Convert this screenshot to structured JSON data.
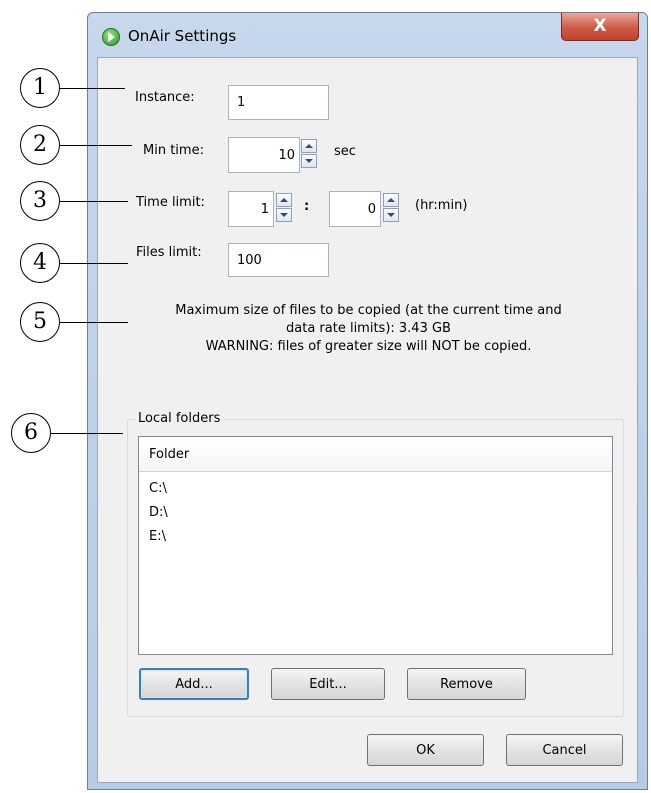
{
  "window": {
    "title": "OnAir Settings",
    "close_label": "X"
  },
  "instance": {
    "label": "Instance:",
    "value": "1"
  },
  "min_time": {
    "label": "Min time:",
    "value": "10",
    "unit": "sec"
  },
  "time_limit": {
    "label": "Time limit:",
    "hours": "1",
    "separator": ":",
    "minutes": "0",
    "unit": "(hr:min)"
  },
  "files_limit": {
    "label": "Files limit:",
    "value": "100"
  },
  "info": {
    "line1": "Maximum size of files to be copied (at the current time and",
    "line2": "data rate limits): 3.43 GB",
    "line3": "WARNING: files of greater size will NOT be copied."
  },
  "local_folders": {
    "group_label": "Local folders",
    "column_header": "Folder",
    "items": [
      "C:\\",
      "D:\\",
      "E:\\"
    ],
    "add_label": "Add...",
    "edit_label": "Edit...",
    "remove_label": "Remove"
  },
  "footer": {
    "ok_label": "OK",
    "cancel_label": "Cancel"
  },
  "callouts": [
    "1",
    "2",
    "3",
    "4",
    "5",
    "6"
  ],
  "colors": {
    "titlebar": "#c7d7ec",
    "close_button": "#c0432d",
    "dialog_bg": "#f0f0f0",
    "default_button_border": "#3c7fb1"
  },
  "icons": {
    "app": "onair-play-icon",
    "close": "close-icon"
  }
}
